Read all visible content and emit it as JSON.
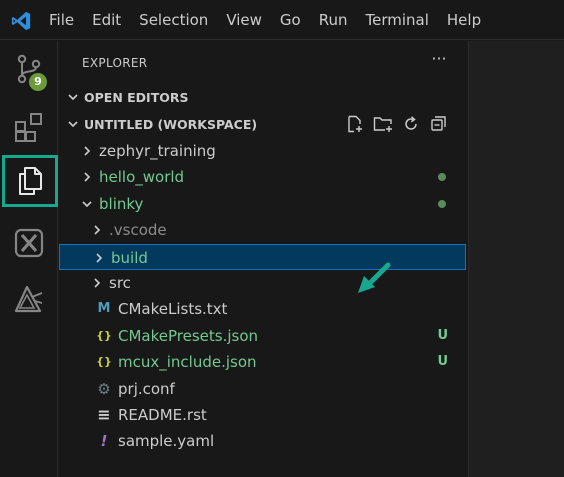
{
  "menu": [
    "File",
    "Edit",
    "Selection",
    "View",
    "Go",
    "Run",
    "Terminal",
    "Help"
  ],
  "activity_bar": {
    "source_control_badge": "9"
  },
  "explorer": {
    "title": "EXPLORER",
    "more_actions": "···",
    "open_editors": "OPEN EDITORS",
    "workspace": "UNTITLED (WORKSPACE)",
    "tree": [
      {
        "name": "zephyr_training",
        "kind": "folder",
        "expanded": false,
        "depth": 0,
        "color": "white"
      },
      {
        "name": "hello_world",
        "kind": "folder",
        "expanded": false,
        "depth": 0,
        "color": "green",
        "decoration": "dot"
      },
      {
        "name": "blinky",
        "kind": "folder",
        "expanded": true,
        "depth": 0,
        "color": "green",
        "decoration": "dot"
      },
      {
        "name": ".vscode",
        "kind": "folder",
        "expanded": false,
        "depth": 1,
        "color": "gray"
      },
      {
        "name": "build",
        "kind": "folder",
        "expanded": false,
        "depth": 1,
        "color": "green",
        "selected": true
      },
      {
        "name": "src",
        "kind": "folder",
        "expanded": false,
        "depth": 1,
        "color": "white"
      },
      {
        "name": "CMakeLists.txt",
        "kind": "file",
        "icon": "cmake-icon",
        "depth": 1,
        "color": "white"
      },
      {
        "name": "CMakePresets.json",
        "kind": "file",
        "icon": "json-icon",
        "depth": 1,
        "color": "green",
        "decoration": "U"
      },
      {
        "name": "mcux_include.json",
        "kind": "file",
        "icon": "json-icon",
        "depth": 1,
        "color": "green",
        "decoration": "U"
      },
      {
        "name": "prj.conf",
        "kind": "file",
        "icon": "gear-icon",
        "depth": 1,
        "color": "white"
      },
      {
        "name": "README.rst",
        "kind": "file",
        "icon": "lines-icon",
        "depth": 1,
        "color": "white"
      },
      {
        "name": "sample.yaml",
        "kind": "file",
        "icon": "exclamation-icon",
        "depth": 1,
        "color": "white"
      }
    ]
  },
  "colors": {
    "accent_teal": "#17a98f",
    "git_green": "#73c991",
    "selection_bg": "#04395e",
    "selection_border": "#0e74c4"
  }
}
